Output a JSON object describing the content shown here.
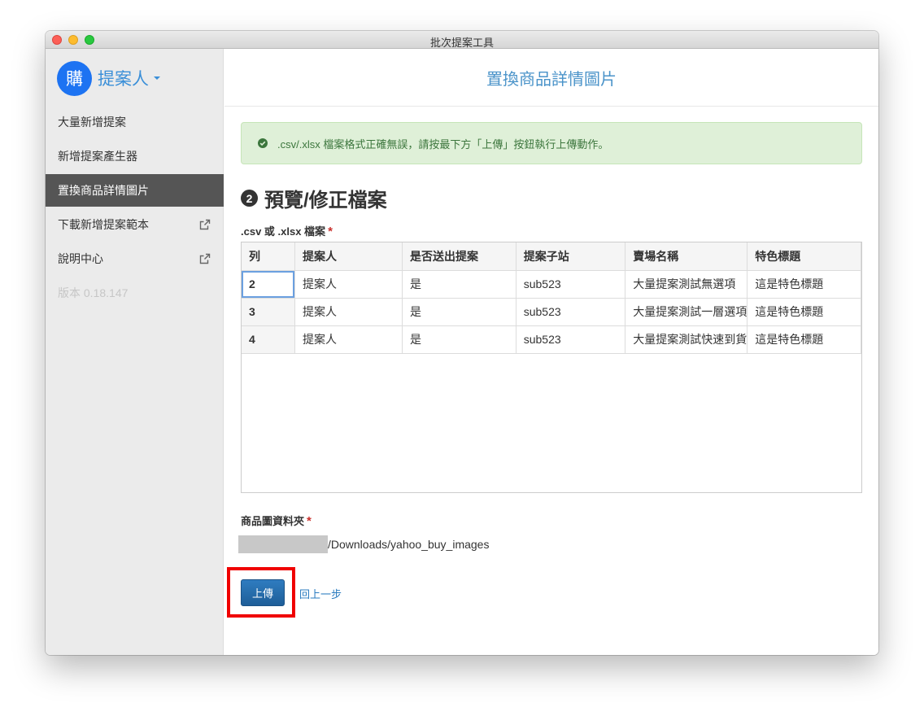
{
  "window": {
    "title": "批次提案工具"
  },
  "sidebar": {
    "avatar_char": "購",
    "user_name": "提案人",
    "items": [
      {
        "label": "大量新增提案",
        "active": false,
        "external": false
      },
      {
        "label": "新增提案產生器",
        "active": false,
        "external": false
      },
      {
        "label": "置換商品詳情圖片",
        "active": true,
        "external": false
      },
      {
        "label": "下載新增提案範本",
        "active": false,
        "external": true
      },
      {
        "label": "說明中心",
        "active": false,
        "external": true
      }
    ],
    "version": "版本 0.18.147"
  },
  "main": {
    "page_title": "置換商品詳情圖片",
    "alert": ".csv/.xlsx 檔案格式正確無誤，請按最下方「上傳」按鈕執行上傳動作。",
    "step_number": "2",
    "section_title": "預覽/修正檔案",
    "file_label": ".csv 或 .xlsx 檔案",
    "required_mark": "*",
    "table": {
      "headers": [
        "列",
        "提案人",
        "是否送出提案",
        "提案子站",
        "賣場名稱",
        "特色標題"
      ],
      "rows": [
        [
          "2",
          "提案人",
          "是",
          "sub523",
          "大量提案測試無選項",
          "這是特色標題"
        ],
        [
          "3",
          "提案人",
          "是",
          "sub523",
          "大量提案測試一層選項",
          "這是特色標題"
        ],
        [
          "4",
          "提案人",
          "是",
          "sub523",
          "大量提案測試快速到貨",
          "這是特色標題"
        ]
      ]
    },
    "folder_label": "商品圖資料夾",
    "folder_path": "/Downloads/yahoo_buy_images",
    "upload_button": "上傳",
    "back_link": "回上一步"
  },
  "colors": {
    "accent": "#3a8fd8",
    "avatar": "#1d73f2",
    "active_nav": "#555555",
    "alert_bg": "#dff0d8",
    "alert_text": "#3c763d",
    "button": "#2a6fae",
    "highlight": "#f00000"
  },
  "icons": {
    "external": "external-link-icon",
    "alert": "check-circle-icon",
    "caret": "caret-down-icon"
  }
}
